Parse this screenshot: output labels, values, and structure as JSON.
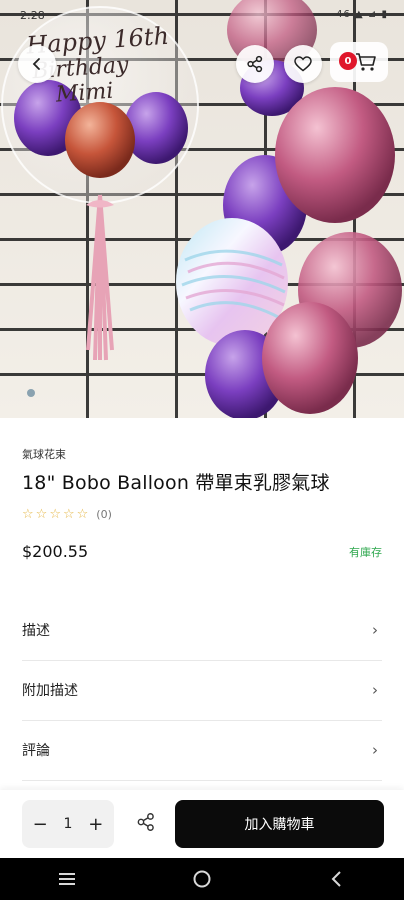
{
  "status_bar": {
    "time": "2:28",
    "right_text": "46 ▲ ⊿ ▮"
  },
  "hero": {
    "banner_text_line1": "Happy 16th",
    "banner_text_line2": "Birthday",
    "banner_text_line3": "Mimi",
    "dots_total": 1,
    "dot_active": 1
  },
  "header_icons": {
    "back": "chevron-left-icon",
    "share": "share-icon",
    "favorite": "heart-icon",
    "cart": "cart-icon",
    "cart_count": "0"
  },
  "product": {
    "category": "氣球花束",
    "title": "18\" Bobo Balloon 帶單束乳膠氣球",
    "rating_stars": 5,
    "review_count": "(0)",
    "price": "$200.55",
    "stock_status": "有庫存"
  },
  "sections": [
    {
      "label": "描述"
    },
    {
      "label": "附加描述"
    },
    {
      "label": "評論"
    }
  ],
  "bottom_bar": {
    "minus": "−",
    "quantity": "1",
    "plus": "+",
    "add_to_cart": "加入購物車"
  },
  "colors": {
    "accent": "#0b0b0b",
    "badge": "#e0172b",
    "stock": "#2fa84f",
    "star": "#e6b84a"
  }
}
